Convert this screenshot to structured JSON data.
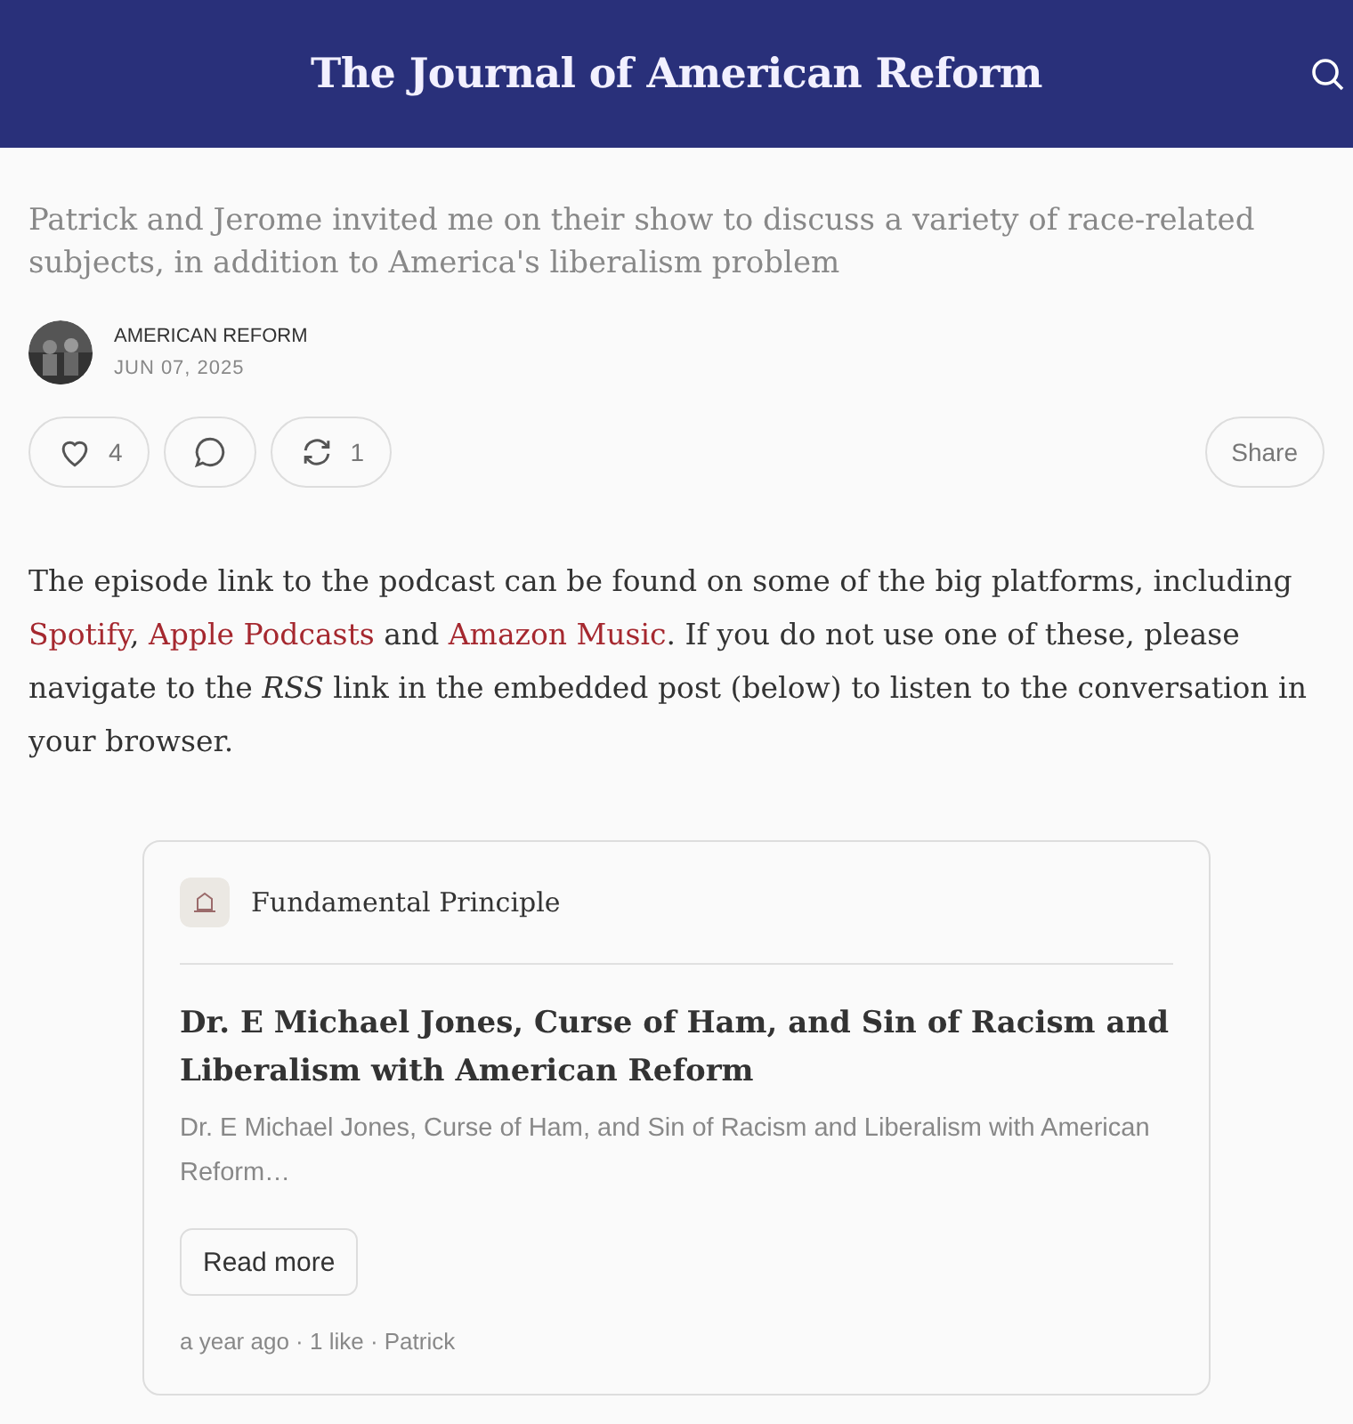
{
  "header": {
    "title": "The Journal of American Reform"
  },
  "post": {
    "subtitle": "Patrick and Jerome invited me on their show to discuss a variety of race-related subjects, in addition to America's liberalism problem",
    "author": "AMERICAN REFORM",
    "date": "JUN 07, 2025"
  },
  "actions": [
    {
      "kind": "like",
      "count": "4"
    },
    {
      "kind": "comment"
    },
    {
      "kind": "restack",
      "count": "1"
    }
  ],
  "share": "Share",
  "body": [
    {
      "kind": "text",
      "text": "The episode link to the podcast can be found on some of the big platforms, including "
    },
    {
      "kind": "link",
      "text": "Spotify"
    },
    {
      "kind": "text",
      "text": ", "
    },
    {
      "kind": "link",
      "text": "Apple Podcasts"
    },
    {
      "kind": "text",
      "text": " and "
    },
    {
      "kind": "link",
      "text": "Amazon Music"
    },
    {
      "kind": "text",
      "text": ". If you do not use one of these, please navigate to the *RSS* link in the embedded post (below) to listen to the conversation in your browser."
    }
  ],
  "embed": {
    "publication": "Fundamental Principle",
    "title": "Dr. E Michael Jones, Curse of Ham, and Sin of Racism and Liberalism with American Reform",
    "excerpt": "Dr. E Michael Jones, Curse of Ham, and Sin of Racism and Liberalism with American Reform…",
    "button": "Read more",
    "meta": "a year ago · 1 like · Patrick"
  }
}
